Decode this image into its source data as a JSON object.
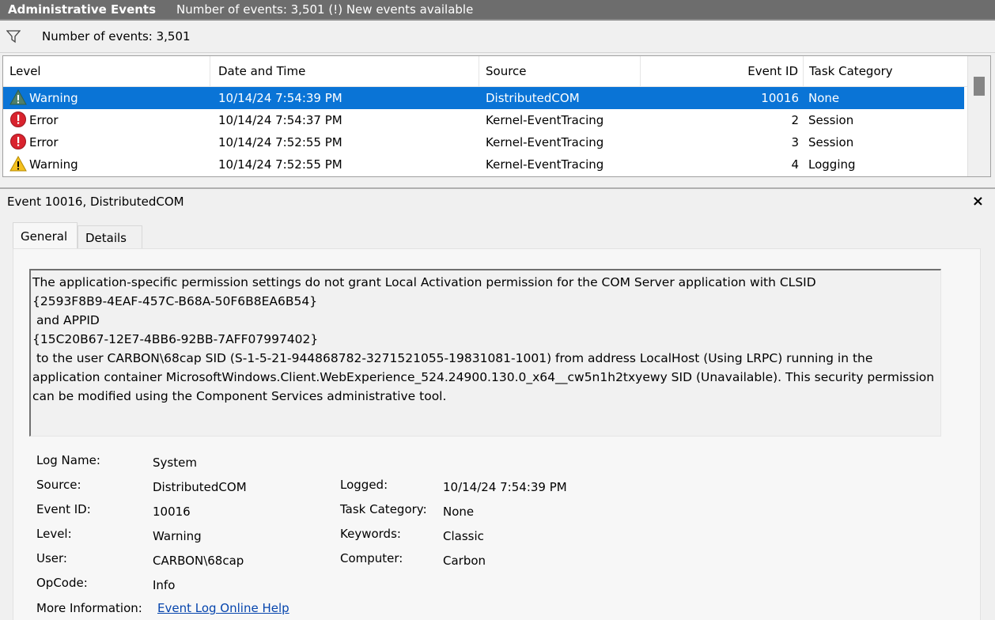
{
  "titlebar": {
    "title": "Administrative Events",
    "summary": "Number of events: 3,501 (!) New events available"
  },
  "filterbar": {
    "icon": "filter-icon",
    "text": "Number of events: 3,501"
  },
  "grid": {
    "columns": [
      "Level",
      "Date and Time",
      "Source",
      "Event ID",
      "Task Category"
    ],
    "rows": [
      {
        "level": "Warning",
        "icon": "warning-icon",
        "date": "10/14/24 7:54:39 PM",
        "source": "DistributedCOM",
        "event_id": "10016",
        "task": "None",
        "selected": true
      },
      {
        "level": "Error",
        "icon": "error-icon",
        "date": "10/14/24 7:54:37 PM",
        "source": "Kernel-EventTracing",
        "event_id": "2",
        "task": "Session"
      },
      {
        "level": "Error",
        "icon": "error-icon",
        "date": "10/14/24 7:52:55 PM",
        "source": "Kernel-EventTracing",
        "event_id": "3",
        "task": "Session"
      },
      {
        "level": "Warning",
        "icon": "warning-icon",
        "date": "10/14/24 7:52:55 PM",
        "source": "Kernel-EventTracing",
        "event_id": "4",
        "task": "Logging"
      }
    ]
  },
  "detail": {
    "header": "Event 10016, DistributedCOM",
    "close": "×",
    "tabs": [
      "General",
      "Details"
    ],
    "description": "The application-specific permission settings do not grant Local Activation permission for the COM Server application with CLSID\n{2593F8B9-4EAF-457C-B68A-50F6B8EA6B54}\n and APPID\n{15C20B67-12E7-4BB6-92BB-7AFF07997402}\n to the user CARBON\\68cap SID (S-1-5-21-944868782-3271521055-19831081-1001) from address LocalHost (Using LRPC) running in the application container MicrosoftWindows.Client.WebExperience_524.24900.130.0_x64__cw5n1h2txyewy SID (Unavailable). This security permission can be modified using the Component Services administrative tool.",
    "labels": {
      "log_name": "Log Name:",
      "source": "Source:",
      "event_id": "Event ID:",
      "level": "Level:",
      "user": "User:",
      "opcode": "OpCode:",
      "more_info": "More Information:",
      "logged": "Logged:",
      "task_category": "Task Category:",
      "keywords": "Keywords:",
      "computer": "Computer:"
    },
    "values": {
      "log_name": "System",
      "source": "DistributedCOM",
      "event_id": "10016",
      "level": "Warning",
      "user": "CARBON\\68cap",
      "opcode": "Info",
      "more_info": "Event Log Online Help",
      "logged": "10/14/24 7:54:39 PM",
      "task_category": "None",
      "keywords": "Classic",
      "computer": "Carbon"
    }
  }
}
